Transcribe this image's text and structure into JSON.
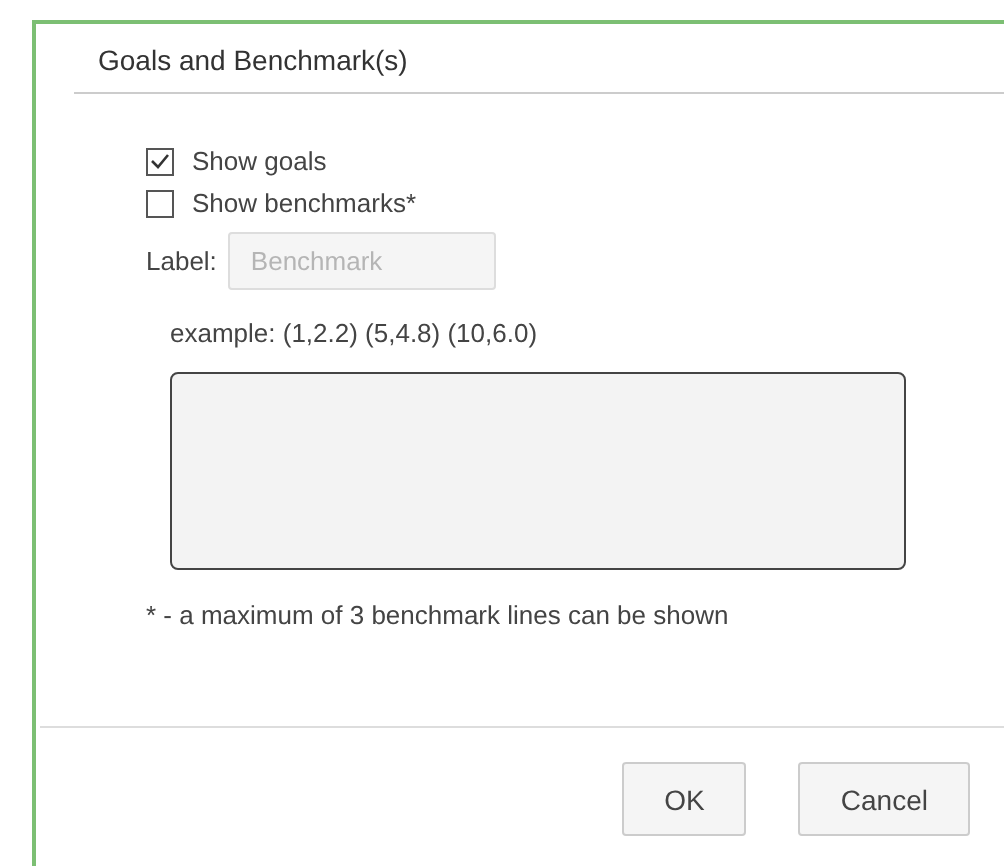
{
  "dialog": {
    "title": "Goals and Benchmark(s)"
  },
  "options": [
    {
      "label": "Show goals",
      "checked": true
    },
    {
      "label": "Show benchmarks*",
      "checked": false
    }
  ],
  "label_field": {
    "label": "Label:",
    "placeholder": "Benchmark",
    "disabled": true
  },
  "example": "example: (1,2.2) (5,4.8) (10,6.0)",
  "points_field": {
    "disabled": true
  },
  "footnote": "* - a maximum of 3 benchmark lines can be shown",
  "buttons": [
    "OK",
    "Cancel"
  ]
}
